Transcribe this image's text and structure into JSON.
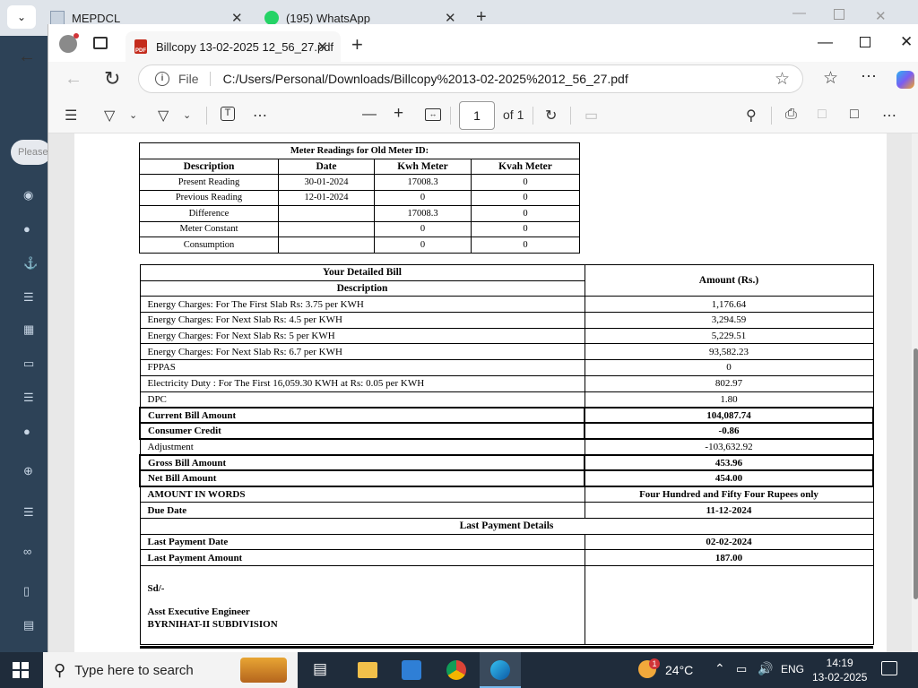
{
  "background_browser": {
    "tabs": [
      {
        "title": "MEPDCL",
        "close": "✕"
      },
      {
        "title": "(195) WhatsApp",
        "close": "✕"
      }
    ],
    "new_tab": "+",
    "search_placeholder": "Please"
  },
  "edge": {
    "tab_title": "Billcopy 13-02-2025 12_56_27.pdf",
    "tab_close": "✕",
    "new_tab": "+",
    "file_label": "File",
    "url": "C:/Users/Personal/Downloads/Billcopy%2013-02-2025%2012_56_27.pdf",
    "page_number": "1",
    "page_of": "of 1"
  },
  "meter_table": {
    "caption": "Meter Readings for Old Meter ID:",
    "headers": [
      "Description",
      "Date",
      "Kwh Meter",
      "Kvah Meter"
    ],
    "rows": [
      [
        "Present Reading",
        "30-01-2024",
        "17008.3",
        "0"
      ],
      [
        "Previous Reading",
        "12-01-2024",
        "0",
        "0"
      ],
      [
        "Difference",
        "",
        "17008.3",
        "0"
      ],
      [
        "Meter Constant",
        "",
        "0",
        "0"
      ],
      [
        "Consumption",
        "",
        "0",
        "0"
      ]
    ]
  },
  "bill_table": {
    "title": "Your Detailed Bill",
    "desc_header": "Description",
    "amount_header": "Amount (Rs.)",
    "rows": [
      {
        "label": "Energy Charges: For The First Slab Rs: 3.75 per KWH",
        "amount": "1,176.64"
      },
      {
        "label": "Energy Charges: For Next Slab Rs: 4.5 per KWH",
        "amount": "3,294.59"
      },
      {
        "label": "Energy Charges: For Next Slab Rs: 5 per KWH",
        "amount": "5,229.51"
      },
      {
        "label": "Energy Charges: For Next Slab Rs: 6.7 per KWH",
        "amount": "93,582.23"
      },
      {
        "label": "FPPAS",
        "amount": "0"
      },
      {
        "label": "Electricity Duty : For The First 16,059.30 KWH at Rs: 0.05 per KWH",
        "amount": "802.97"
      },
      {
        "label": "DPC",
        "amount": "1.80"
      },
      {
        "label": "Current Bill Amount",
        "amount": "104,087.74"
      },
      {
        "label": "Consumer Credit",
        "amount": "-0.86"
      },
      {
        "label": "Adjustment",
        "amount": "-103,632.92"
      },
      {
        "label": "Gross Bill Amount",
        "amount": "453.96"
      },
      {
        "label": "Net Bill Amount",
        "amount": "454.00"
      },
      {
        "label": "AMOUNT IN WORDS",
        "amount": "Four Hundred and Fifty Four Rupees only"
      },
      {
        "label": "Due Date",
        "amount": "11-12-2024"
      }
    ],
    "last_payment_header": "Last Payment Details",
    "last_payment": [
      {
        "label": "Last Payment Date",
        "amount": "02-02-2024"
      },
      {
        "label": "Last Payment Amount",
        "amount": "187.00"
      }
    ],
    "signature": {
      "line1": "Sd/-",
      "line2": "Asst Executive Engineer",
      "line3": "BYRNIHAT-II SUBDIVISION"
    }
  },
  "taskbar": {
    "search_placeholder": "Type here to search",
    "weather_badge": "1",
    "temperature": "24°C",
    "language": "ENG",
    "time": "14:19",
    "date": "13-02-2025"
  }
}
